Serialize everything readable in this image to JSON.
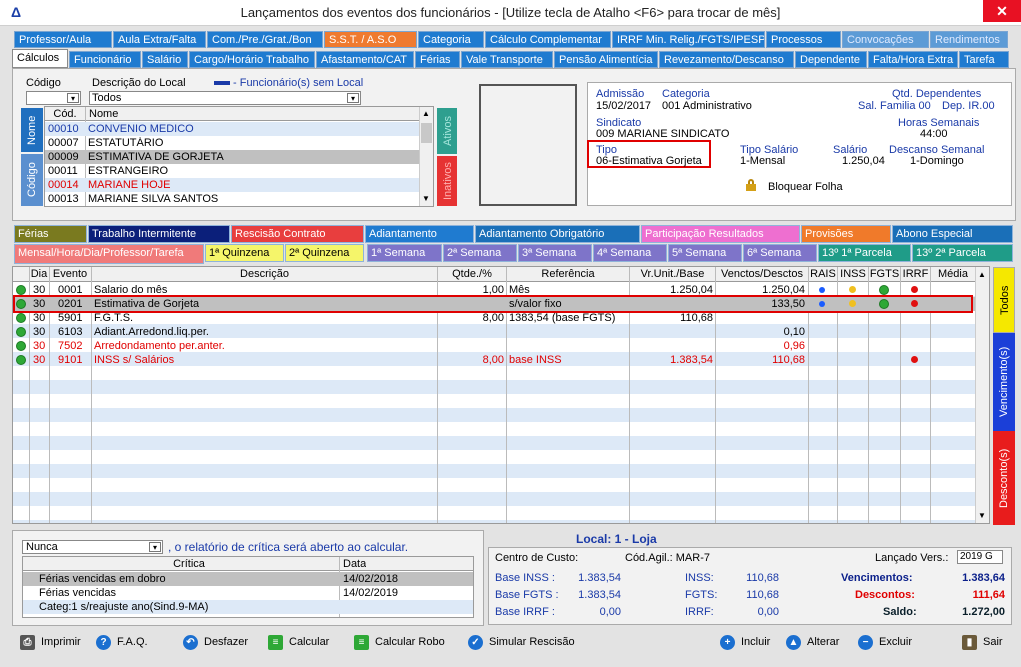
{
  "window": {
    "title": "Lançamentos dos eventos dos funcionários - [Utilize tecla de Atalho <F6> para trocar de mês]",
    "close": "✕"
  },
  "tabs_row1": [
    "Professor/Aula",
    "Aula Extra/Falta",
    "Com./Pre./Grat./Bon",
    "S.S.T. / A.S.O",
    "Categoria",
    "Cálculo Complementar",
    "IRRF Min. Relig./FGTS/IPESP",
    "Processos",
    "Convocações",
    "Rendimentos"
  ],
  "tabs_row2": [
    "Cálculos",
    "Funcionário",
    "Salário",
    "Cargo/Horário Trabalho",
    "Afastamento/CAT",
    "Férias",
    "Vale Transporte",
    "Pensão Alimentícia",
    "Revezamento/Descanso",
    "Dependente",
    "Falta/Hora Extra",
    "Tarefa"
  ],
  "filter": {
    "codigo_label": "Código",
    "descricao_label": "Descrição do Local",
    "legend": "- Funcionário(s) sem Local",
    "descricao_value": "Todos"
  },
  "emp_list": {
    "col_cod": "Cód.",
    "col_nome": "Nome",
    "tab_nome": "Nome",
    "tab_codigo": "Código",
    "side_ativos": "Ativos",
    "side_inativos": "Inativos",
    "rows": [
      {
        "cod": "00010",
        "nome": "CONVENIO MEDICO"
      },
      {
        "cod": "00007",
        "nome": "ESTATUTÁRIO"
      },
      {
        "cod": "00009",
        "nome": "ESTIMATIVA DE GORJETA"
      },
      {
        "cod": "00011",
        "nome": "ESTRANGEIRO"
      },
      {
        "cod": "00014",
        "nome": "MARIANE HOJE"
      },
      {
        "cod": "00013",
        "nome": "MARIANE SILVA SANTOS"
      }
    ]
  },
  "info": {
    "admissao_label": "Admissão",
    "admissao": "15/02/2017",
    "categoria_label": "Categoria",
    "categoria": "001  Administrativo",
    "dependentes_label": "Qtd. Dependentes",
    "sal_familia": "Sal. Familia 00",
    "dep_ir": "Dep. IR.00",
    "sindicato_label": "Sindicato",
    "sindicato": "009  MARIANE SINDICATO",
    "horas_label": "Horas Semanais",
    "horas": "44:00",
    "tipo_label": "Tipo",
    "tipo": "06-Estimativa Gorjeta",
    "tipo_salario_label": "Tipo Salário",
    "tipo_salario": "1-Mensal",
    "salario_label": "Salário",
    "salario": "1.250,04",
    "descanso_label": "Descanso Semanal",
    "descanso": "1-Domingo",
    "bloquear": "Bloquear Folha"
  },
  "tabs_row3": [
    "Férias",
    "Trabalho Intermitente",
    "Rescisão Contrato",
    "Adiantamento",
    "Adiantamento Obrigatório",
    "Participação Resultados",
    "Provisões",
    "Abono Especial"
  ],
  "tabs_row4": [
    "Mensal/Hora/Dia/Professor/Tarefa",
    "1ª Quinzena",
    "2ª Quinzena",
    "1ª Semana",
    "2ª Semana",
    "3ª Semana",
    "4ª Semana",
    "5ª Semana",
    "6ª Semana",
    "13º  1ª Parcela",
    "13º  2ª Parcela"
  ],
  "grid": {
    "headers": [
      "Dia",
      "Evento",
      "Descrição",
      "Qtde./%",
      "Referência",
      "Vr.Unit./Base",
      "Venctos/Desctos",
      "RAIS",
      "INSS",
      "FGTS",
      "IRRF",
      "Média"
    ],
    "rows": [
      {
        "dia": "30",
        "evento": "0001",
        "desc": "Salario do mês",
        "qtde": "1,00",
        "ref": "Mês",
        "base": "1.250,04",
        "valor": "1.250,04",
        "red": false
      },
      {
        "dia": "30",
        "evento": "0201",
        "desc": "Estimativa de Gorjeta",
        "qtde": "",
        "ref": "s/valor fixo",
        "base": "",
        "valor": "133,50",
        "red": false
      },
      {
        "dia": "30",
        "evento": "5901",
        "desc": "F.G.T.S.",
        "qtde": "8,00",
        "ref": "1383,54 (base FGTS)",
        "base": "110,68",
        "valor": "",
        "red": false
      },
      {
        "dia": "30",
        "evento": "6103",
        "desc": "Adiant.Arredond.liq.per.",
        "qtde": "",
        "ref": "",
        "base": "",
        "valor": "0,10",
        "red": false
      },
      {
        "dia": "30",
        "evento": "7502",
        "desc": "Arredondamento per.anter.",
        "qtde": "",
        "ref": "",
        "base": "",
        "valor": "0,96",
        "red": true
      },
      {
        "dia": "30",
        "evento": "9101",
        "desc": "INSS s/ Salários",
        "qtde": "8,00",
        "ref": "base INSS",
        "base": "1.383,54",
        "valor": "110,68",
        "red": true
      }
    ]
  },
  "side_tabs": {
    "todos": "Todos",
    "vencimentos": "Vencimento(s)",
    "descontos": "Desconto(s)"
  },
  "critica": {
    "select": "Nunca",
    "text": ", o relatório de crítica será aberto ao calcular.",
    "col1": "Crítica",
    "col2": "Data",
    "rows": [
      {
        "c": "Férias vencidas em dobro",
        "d": "14/02/2018"
      },
      {
        "c": "Férias vencidas",
        "d": "14/02/2019"
      },
      {
        "c": "Categ:1 s/reajuste ano(Sind.9-MA)",
        "d": ""
      }
    ]
  },
  "totals": {
    "local": "Local: 1 - Loja",
    "cc_label": "Centro de Custo:",
    "cod_agil": "Cód.Agil.:  MAR-7",
    "lancado": "Lançado Vers.:",
    "versao": "2019 G",
    "base_inss_l": "Base  INSS :",
    "base_inss": "1.383,54",
    "inss_l": "INSS:",
    "inss": "110,68",
    "venc_l": "Vencimentos:",
    "venc": "1.383,64",
    "base_fgts_l": "Base FGTS :",
    "base_fgts": "1.383,54",
    "fgts_l": "FGTS:",
    "fgts": "110,68",
    "desc_l": "Descontos:",
    "desc": "111,64",
    "base_irrf_l": "Base  IRRF :",
    "base_irrf": "0,00",
    "irrf_l": "IRRF:",
    "irrf": "0,00",
    "saldo_l": "Saldo:",
    "saldo": "1.272,00"
  },
  "buttons": {
    "imprimir": "Imprimir",
    "faq": "F.A.Q.",
    "desfazer": "Desfazer",
    "calcular": "Calcular",
    "calcular_robo": "Calcular Robo",
    "simular": "Simular Rescisão",
    "incluir": "Incluir",
    "alterar": "Alterar",
    "excluir": "Excluir",
    "sair": "Sair"
  },
  "colors": {
    "tab_blue": "#1f7bd0",
    "highlight_red": "#e00000",
    "selected_row": "#c0c0c0"
  }
}
